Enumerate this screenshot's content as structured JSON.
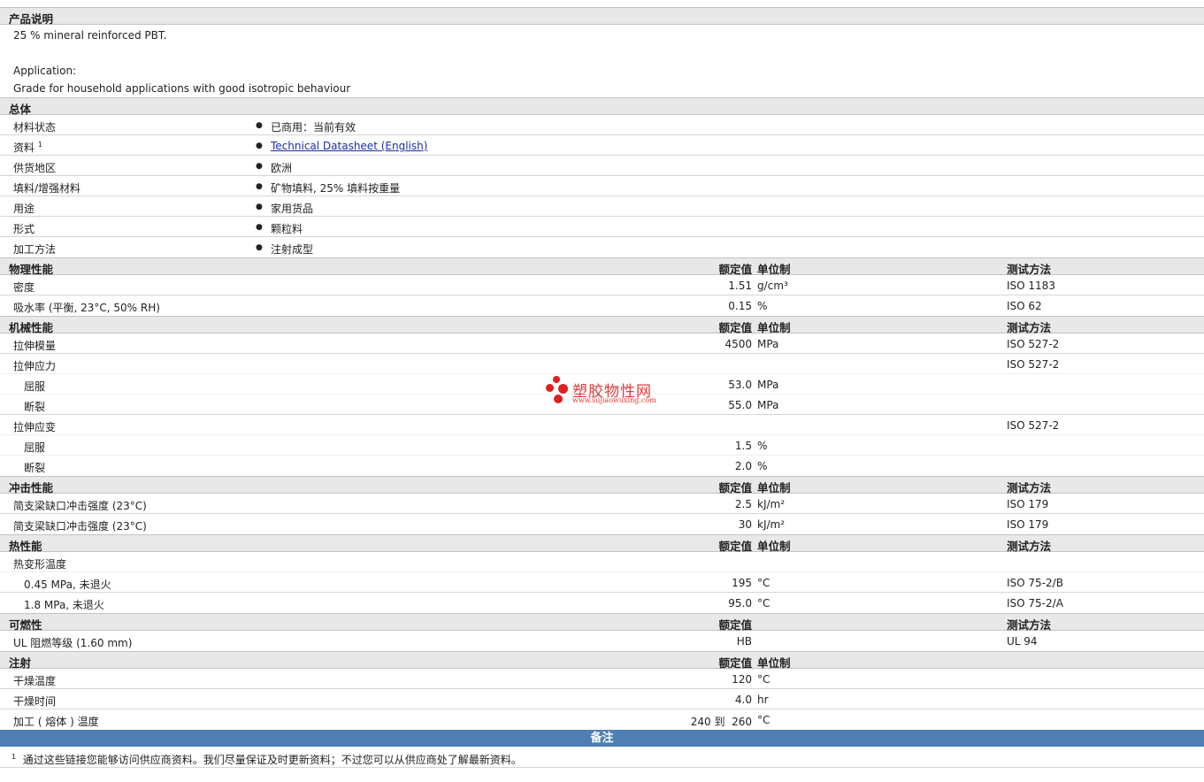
{
  "desc": {
    "header": "产品说明",
    "line1": "25 % mineral reinforced PBT.",
    "line2": "Application:",
    "line3": "Grade for household applications with good isotropic behaviour"
  },
  "general": {
    "header": "总体",
    "rows": [
      {
        "label": "材料状态",
        "value": "已商用：当前有效"
      },
      {
        "label": "资料",
        "sup": "1",
        "value": "Technical Datasheet (English)"
      },
      {
        "label": "供货地区",
        "value": "欧洲"
      },
      {
        "label": "填料/增强材料",
        "value": "矿物填料, 25% 填料按重量"
      },
      {
        "label": "用途",
        "value": "家用货品"
      },
      {
        "label": "形式",
        "value": "颗粒料"
      },
      {
        "label": "加工方法",
        "value": "注射成型"
      }
    ]
  },
  "cols": {
    "value": "额定值",
    "unit": "单位制",
    "test": "测试方法"
  },
  "physical": {
    "header": "物理性能",
    "rows": [
      {
        "label": "密度",
        "value": "1.51",
        "unit": "g/cm³",
        "test": "ISO 1183"
      },
      {
        "label": "吸水率 (平衡, 23°C, 50% RH)",
        "value": "0.15",
        "unit": "%",
        "test": "ISO 62"
      }
    ]
  },
  "mechanical": {
    "header": "机械性能",
    "rows": [
      {
        "label": "拉伸模量",
        "value": "4500",
        "unit": "MPa",
        "test": "ISO 527-2"
      },
      {
        "label": "拉伸应力",
        "value": "",
        "unit": "",
        "test": "ISO 527-2"
      },
      {
        "label": "屈服",
        "value": "53.0",
        "unit": "MPa",
        "test": "",
        "sub": true
      },
      {
        "label": "断裂",
        "value": "55.0",
        "unit": "MPa",
        "test": "",
        "sub": true
      },
      {
        "label": "拉伸应变",
        "value": "",
        "unit": "",
        "test": "ISO 527-2"
      },
      {
        "label": "屈服",
        "value": "1.5",
        "unit": "%",
        "test": "",
        "sub": true
      },
      {
        "label": "断裂",
        "value": "2.0",
        "unit": "%",
        "test": "",
        "sub": true
      }
    ]
  },
  "impact": {
    "header": "冲击性能",
    "rows": [
      {
        "label": "简支梁缺口冲击强度 (23°C)",
        "value": "2.5",
        "unit": "kJ/m²",
        "test": "ISO 179"
      },
      {
        "label": "简支梁缺口冲击强度 (23°C)",
        "value": "30",
        "unit": "kJ/m²",
        "test": "ISO 179"
      }
    ]
  },
  "thermal": {
    "header": "热性能",
    "rows": [
      {
        "label": "热变形温度",
        "value": "",
        "unit": "",
        "test": ""
      },
      {
        "label": "0.45 MPa, 未退火",
        "value": "195",
        "unit": "°C",
        "test": "ISO 75-2/B",
        "sub": true
      },
      {
        "label": "1.8 MPa, 未退火",
        "value": "95.0",
        "unit": "°C",
        "test": "ISO 75-2/A",
        "sub": true
      }
    ]
  },
  "flammability": {
    "header": "可燃性",
    "rows": [
      {
        "label": "UL 阻燃等级 (1.60 mm)",
        "value": "HB",
        "unit": "",
        "test": "UL 94"
      }
    ]
  },
  "injection": {
    "header": "注射",
    "rows": [
      {
        "label": "干燥温度",
        "value": "120",
        "unit": "°C",
        "test": ""
      },
      {
        "label": "干燥时间",
        "value": "4.0",
        "unit": "hr",
        "test": ""
      },
      {
        "label": "加工 ( 熔体 ) 温度",
        "value": "240 到  260",
        "unit": "°C",
        "test": ""
      }
    ]
  },
  "notes": {
    "header": "备注",
    "footnote_sup": "1",
    "footnote": "通过这些链接您能够访问供应商资料。我们尽量保证及时更新资料；不过您可以从供应商处了解最新资料。"
  },
  "watermark": {
    "title": "塑胶物性网",
    "url": "www.sujiaowuxing.com"
  }
}
